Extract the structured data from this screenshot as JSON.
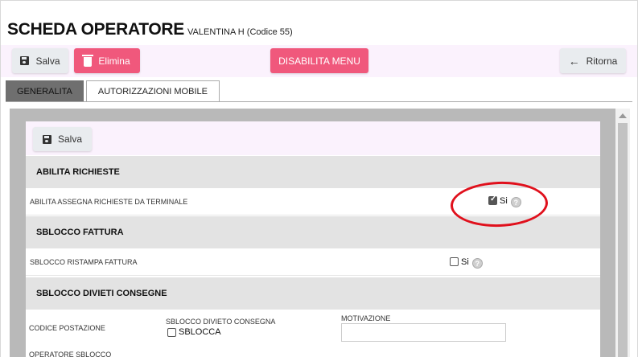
{
  "header": {
    "title": "SCHEDA OPERATORE",
    "subtitle": "VALENTINA H (Codice 55)"
  },
  "toolbar": {
    "save_label": "Salva",
    "delete_label": "Elimina",
    "disable_menu_label": "DISABILITA MENU",
    "back_label": "Ritorna"
  },
  "tabs": [
    {
      "label": "GENERALITA",
      "active": false
    },
    {
      "label": "AUTORIZZAZIONI MOBILE",
      "active": true
    }
  ],
  "form": {
    "save_label": "Salva",
    "sections": [
      {
        "title": "ABILITA RICHIESTE",
        "row_label": "ABILITA ASSEGNA RICHIESTE DA TERMINALE",
        "option_label": "Si",
        "checked": true
      },
      {
        "title": "SBLOCCO FATTURA",
        "row_label": "SBLOCCO RISTAMPA FATTURA",
        "option_label": "Si",
        "checked": false
      },
      {
        "title": "SBLOCCO DIVIETI CONSEGNE"
      }
    ],
    "divieti": {
      "codice_postazione_label": "CODICE POSTAZIONE",
      "sblocco_divieto_label": "SBLOCCO DIVIETO CONSEGNA",
      "sblocca_label": "SBLOCCA",
      "sblocca_checked": false,
      "motivazione_label": "MOTIVAZIONE",
      "motivazione_value": "",
      "operatore_sblocco_label": "OPERATORE SBLOCCO"
    },
    "help_glyph": "?"
  },
  "colors": {
    "accent_pink": "#f0587c",
    "toolbar_bg": "#fbf2fd",
    "section_bg": "#e3e3e3",
    "annotation_red": "#e0101c"
  }
}
